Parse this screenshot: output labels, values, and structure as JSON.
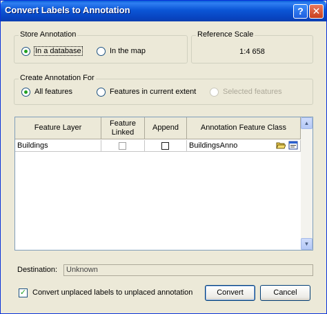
{
  "window": {
    "title": "Convert Labels to Annotation",
    "help_glyph": "?",
    "close_glyph": "✕"
  },
  "store_annotation": {
    "label": "Store Annotation",
    "options": [
      {
        "label": "In a database",
        "selected": true
      },
      {
        "label": "In the map",
        "selected": false
      }
    ]
  },
  "reference_scale": {
    "label": "Reference Scale",
    "value": "1:4 658"
  },
  "create_annotation_for": {
    "label": "Create Annotation For",
    "options": [
      {
        "label": "All features",
        "selected": true,
        "enabled": true
      },
      {
        "label": "Features in current extent",
        "selected": false,
        "enabled": true
      },
      {
        "label": "Selected features",
        "selected": false,
        "enabled": false
      }
    ]
  },
  "table": {
    "columns": [
      "Feature Layer",
      "Feature Linked",
      "Append",
      "Annotation Feature Class"
    ],
    "rows": [
      {
        "feature_layer": "Buildings",
        "feature_linked": false,
        "append": false,
        "annotation_feature_class": "BuildingsAnno"
      }
    ]
  },
  "destination": {
    "label": "Destination:",
    "value": "Unknown"
  },
  "convert_unplaced": {
    "label": "Convert unplaced labels to unplaced annotation",
    "checked": true,
    "check_glyph": "✓"
  },
  "buttons": {
    "convert": "Convert",
    "cancel": "Cancel"
  },
  "scroll_up_glyph": "▲",
  "scroll_down_glyph": "▼",
  "colors": {
    "title_bar": "#0a4fd0",
    "dialog_bg": "#ece9d8",
    "radio_dot": "#21a121"
  }
}
